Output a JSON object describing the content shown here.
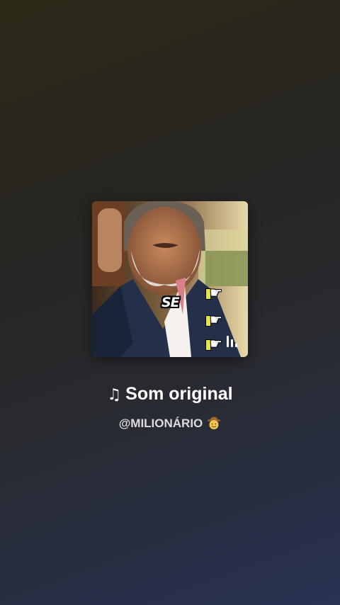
{
  "sound": {
    "title": "Som original",
    "author": "@MILIONÁRIO"
  },
  "cover": {
    "caption": "SE",
    "icons": [
      "pointing-hand-icon",
      "pointing-hand-icon",
      "pointing-hand-icon",
      "audio-bars-icon"
    ]
  },
  "icons": {
    "note": "music-note-icon",
    "author_emoji": "cowboy-hat-face-icon"
  },
  "colors": {
    "background_top": "#2e2a19",
    "background_bottom": "#283252",
    "title": "#ffffff",
    "author": "#dcdcdc"
  }
}
